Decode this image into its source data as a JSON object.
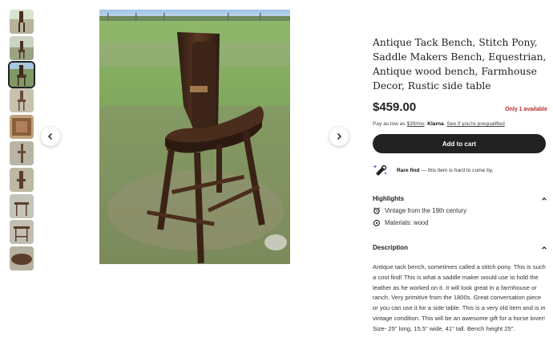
{
  "listing": {
    "title": "Antique Tack Bench, Stitch Pony, Saddle Makers Bench, Equestrian, Antique wood bench, Farmhouse Decor, Rustic side table",
    "price": "$459.00",
    "stock_note": "Only 1 available",
    "klarna": {
      "prefix": "Pay as low as ",
      "amount": "$39/mo",
      "middle": ". ",
      "brand": "Klarna",
      "link": "See if you're prequalified"
    },
    "cart_button": "Add to cart",
    "rare_find": {
      "label": "Rare find",
      "text": " — this item is hard to come by."
    }
  },
  "highlights": {
    "heading": "Highlights",
    "items": [
      {
        "icon": "vintage-icon",
        "text": "Vintage from the 19th century"
      },
      {
        "icon": "materials-icon",
        "text": "Materials: wood"
      }
    ]
  },
  "description": {
    "heading": "Description",
    "text": "Antique tack bench, sometimes called a stitch pony. This is such a cool find! This is what a saddle maker would use to hold the leather as he worked on it. It will look great in a farmhouse or ranch. Very primitive from the 1800s. Great conversation piece or you can use it for a side table. This is a very old item and is in vintage condition. This will be an awesome gift for a horse lover! Size- 25\" long, 15.5\" wide, 41\" tall. Bench height 25\"."
  },
  "gallery": {
    "thumbnail_count": 10,
    "selected_index": 2
  },
  "colors": {
    "stock_red": "#b9292b",
    "cart_button_bg": "#222222"
  }
}
